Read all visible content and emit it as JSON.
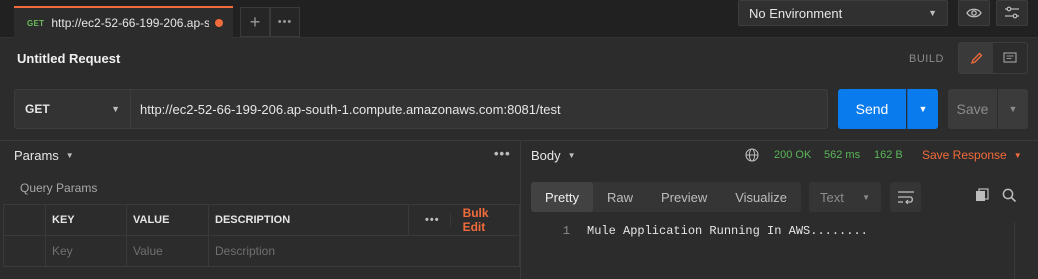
{
  "tab": {
    "method": "GET",
    "title": "http://ec2-52-66-199-206.ap-so..."
  },
  "tabbar": {
    "add_symbol": "+",
    "more_symbol": "•••"
  },
  "environment": {
    "selected": "No Environment"
  },
  "request": {
    "title": "Untitled Request",
    "mode_label": "BUILD",
    "method": "GET",
    "url": "http://ec2-52-66-199-206.ap-south-1.compute.amazonaws.com:8081/test",
    "send_label": "Send",
    "save_label": "Save"
  },
  "params": {
    "header": "Params",
    "section_label": "Query Params",
    "columns": [
      "KEY",
      "VALUE",
      "DESCRIPTION"
    ],
    "bulk_edit_label": "Bulk Edit",
    "placeholder_row": [
      "Key",
      "Value",
      "Description"
    ]
  },
  "response": {
    "header": "Body",
    "status": "200 OK",
    "time": "562 ms",
    "size": "162 B",
    "save_label": "Save Response",
    "view_tabs": [
      "Pretty",
      "Raw",
      "Preview",
      "Visualize"
    ],
    "active_view": "Pretty",
    "format": "Text",
    "lines": [
      {
        "number": "1",
        "text": "Mule Application Running In AWS........"
      }
    ]
  },
  "colors": {
    "accent": "#f26b3a",
    "primary": "#097bed",
    "success": "#5ab55a",
    "method_get": "#6bbd5b"
  },
  "icons": [
    "eye-icon",
    "settings-icon",
    "pencil-icon",
    "comment-icon",
    "globe-icon",
    "wrap-icon",
    "copy-icon",
    "search-icon"
  ]
}
